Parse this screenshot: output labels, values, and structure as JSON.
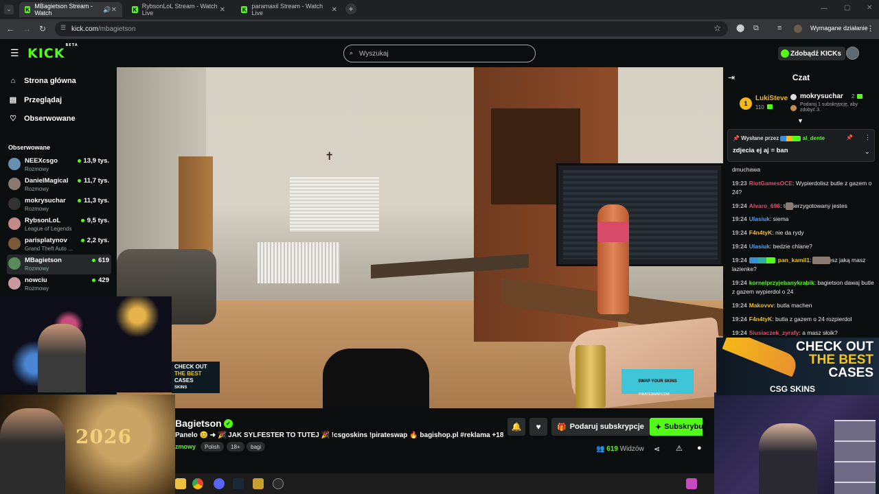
{
  "browser": {
    "tabs": [
      {
        "label": "MBagietson Stream - Watch"
      },
      {
        "label": "RybsonLoL Stream - Watch Live"
      },
      {
        "label": "paramaxil Stream - Watch Live"
      }
    ],
    "url_host": "kick.com",
    "url_path": "/mbagietson",
    "action_required": "Wymagane działanie"
  },
  "header": {
    "logo": "KICK",
    "logo_badge": "BETA",
    "search_placeholder": "Wyszukaj",
    "kicks_button": "Zdobądź KICKs"
  },
  "sidebar": {
    "nav": [
      {
        "label": "Strona główna",
        "icon": "home-icon"
      },
      {
        "label": "Przeglądaj",
        "icon": "browse-icon"
      },
      {
        "label": "Obserwowane",
        "icon": "heart-icon"
      }
    ],
    "following_heading": "Obserwowane",
    "following": [
      {
        "name": "NEEXcsgo",
        "category": "Rozmowy",
        "viewers": "13,9 tys.",
        "color": "#6a8fb0"
      },
      {
        "name": "DanielMagical",
        "category": "Rozmowy",
        "viewers": "11,7 tys.",
        "color": "#8a7a70"
      },
      {
        "name": "mokrysuchar",
        "category": "Rozmowy",
        "viewers": "11,3 tys.",
        "color": "#333333"
      },
      {
        "name": "RybsonLoL",
        "category": "League of Legends",
        "viewers": "9,5 tys.",
        "color": "#c48a8a"
      },
      {
        "name": "parisplatynov",
        "category": "Grand Theft Auto ...",
        "viewers": "2,2 tys.",
        "color": "#7a5a3a"
      },
      {
        "name": "MBagietson",
        "category": "Rozmowy",
        "viewers": "619",
        "color": "#5a8a5a"
      },
      {
        "name": "nowciu",
        "category": "Rozmowy",
        "viewers": "429",
        "color": "#c89aa0"
      }
    ]
  },
  "overlays": {
    "ad_small": {
      "line1": "CHECK OUT",
      "line2": "THE BEST",
      "line3": "CASES",
      "brand": "SKINS"
    },
    "ad_big": {
      "line1": "CHECK OUT",
      "line2": "THE BEST",
      "line3": "CASES",
      "brand": "CSG SKINS"
    },
    "swap_ad": "SWAP YOUR SKINS",
    "swap_site": "PIRATESWAP.COM",
    "new_year": "2026"
  },
  "stream": {
    "streamer": "Bagietson",
    "title": "Panelo 😊 ➜ 🎉 JAK SYLFESTER TO TUTEJ 🎉 !csgoskins !pirateswap 🔥 bagishop.pl #reklama +18",
    "category": "zmowy",
    "tags": [
      "Polish",
      "18+",
      "bagi"
    ],
    "gift_sub": "Podaruj subskrypcje",
    "subscribe": "Subskrybuj",
    "viewers_count": "619",
    "viewers_label": "Widzów"
  },
  "chat": {
    "title": "Czat",
    "leaderboard": [
      {
        "rank": "1",
        "name": "LukiSteve",
        "value": "110"
      },
      {
        "name": "mokrysuchar",
        "value": "2",
        "note": "Podaruj 1 subskrypcję, aby zdobyć 3."
      }
    ],
    "pinned": {
      "label": "Wysłane przez",
      "user": "al_dente",
      "message": "zdjecia ej aj = ban"
    },
    "messages": [
      {
        "time": "",
        "user": "",
        "color": "#ffffff",
        "text": "dmuchawa"
      },
      {
        "time": "19:23",
        "user": "RiotGamesOCE",
        "color": "#e05070",
        "text": ": Wypierdolisz butle z gazem o 24?"
      },
      {
        "time": "19:24",
        "user": "Alvaro_696",
        "color": "#e05070",
        "text": ":    to nierzygotowany jestes"
      },
      {
        "time": "19:24",
        "user": "Ulasiuk",
        "color": "#5aa0ff",
        "text": ": siema"
      },
      {
        "time": "19:24",
        "user": "F4n4tyK",
        "color": "#f0c020",
        "text": ": nie da rydy"
      },
      {
        "time": "19:24",
        "user": "Ulasiuk",
        "color": "#5aa0ff",
        "text": ": bedzie chlane?"
      },
      {
        "time": "19:24",
        "user": "pan_kamil1",
        "color": "#f0c020",
        "text": ":         pokazesz jaką masz lazienke?"
      },
      {
        "time": "19:24",
        "user": "kornelprzyjebanykrabik",
        "color": "#53fc18",
        "text": ": bagietson dawaj butle z gazem wypierdol o 24"
      },
      {
        "time": "19:24",
        "user": "Makovvv",
        "color": "#f0c020",
        "text": ": butla machen"
      },
      {
        "time": "19:24",
        "user": "F4n4tyK",
        "color": "#f0c020",
        "text": ": butla z gazem o 24 rozpierdol"
      },
      {
        "time": "19:24",
        "user": "Siusiaczek_zyrafy",
        "color": "#e05070",
        "text": ": a masz słoik?"
      }
    ]
  }
}
